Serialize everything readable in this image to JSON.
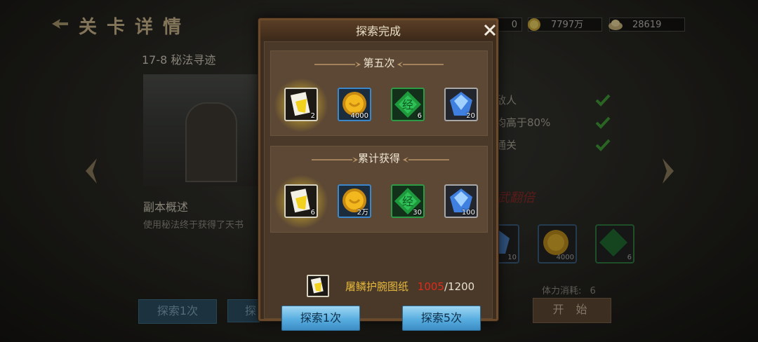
{
  "page": {
    "title": "关卡详情",
    "stage_name": "17-8 秘法寻迹",
    "overview_title": "副本概述",
    "overview_desc": "使用秘法终于获得了天书",
    "conditions": [
      "敌人",
      "均高于80%",
      "通关"
    ],
    "stamp_text": "武翻倍",
    "stamina_label": "体力消耗:",
    "stamina_value": "6",
    "start_label": "开 始",
    "sweep_once_label": "探索1次",
    "sweep_more_label": "探",
    "bg_items": [
      {
        "icon": "gem-icon",
        "count": "10"
      },
      {
        "icon": "gold-coin-icon",
        "count": "4000"
      },
      {
        "icon": "scripture-icon",
        "count": "6"
      }
    ]
  },
  "currency": {
    "first": {
      "icon": "coin-stack-icon",
      "value": "0"
    },
    "gold": {
      "icon": "gold-ingot-icon",
      "value": "7797万"
    },
    "silver": {
      "icon": "silver-ingot-icon",
      "value": "28619"
    }
  },
  "modal": {
    "title": "探索完成",
    "round": {
      "title": "第五次",
      "items": [
        {
          "icon": "blueprint-scroll-icon",
          "count": "2",
          "frame": "white",
          "glow": true
        },
        {
          "icon": "gold-coin-icon",
          "count": "4000",
          "frame": "blue",
          "glow": false
        },
        {
          "icon": "scripture-icon",
          "count": "6",
          "frame": "green",
          "glow": false
        },
        {
          "icon": "gem-icon",
          "count": "20",
          "frame": "gray",
          "glow": false
        }
      ]
    },
    "total": {
      "title": "累计获得",
      "items": [
        {
          "icon": "blueprint-scroll-icon",
          "count": "6",
          "frame": "white",
          "glow": true
        },
        {
          "icon": "gold-coin-icon",
          "count": "2万",
          "frame": "blue",
          "glow": false
        },
        {
          "icon": "scripture-icon",
          "count": "30",
          "frame": "green",
          "glow": false
        },
        {
          "icon": "gem-icon",
          "count": "100",
          "frame": "gray",
          "glow": false
        }
      ]
    },
    "blueprint": {
      "icon": "blueprint-scroll-icon",
      "name": "屠鳞护腕图纸",
      "have": "1005",
      "need": "/1200"
    },
    "explore_once": "探索1次",
    "explore_five": "探索5次"
  },
  "colors": {
    "have_red": "#e02b1c",
    "name_gold": "#e6b93c",
    "button_blue": "#58aee0",
    "modal_brown": "#3b2d20"
  }
}
